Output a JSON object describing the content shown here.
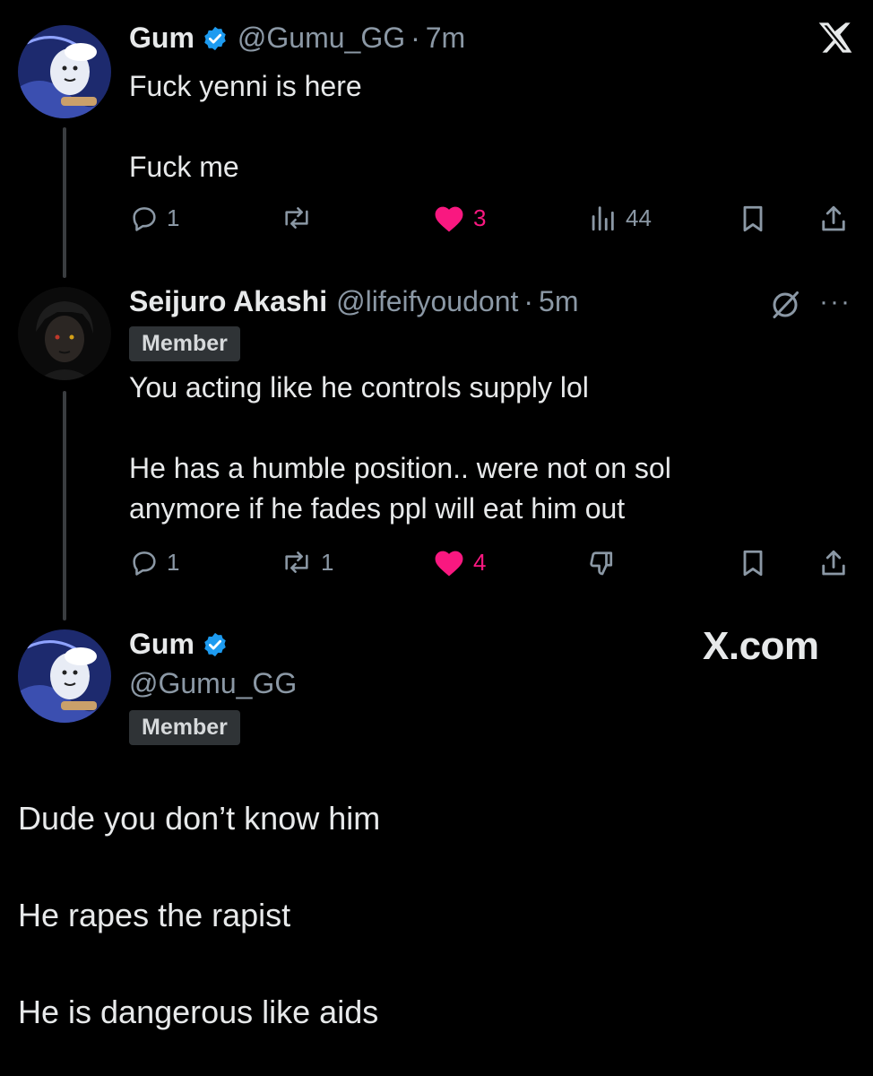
{
  "post1": {
    "name": "Gum",
    "handle": "@Gumu_GG",
    "separator": "·",
    "time": "7m",
    "text": "Fuck yenni is here\n\nFuck me",
    "replies": "1",
    "reposts": "",
    "likes": "3",
    "views": "44"
  },
  "post2": {
    "name": "Seijuro Akashi",
    "handle": "@lifeifyoudont",
    "separator": "·",
    "time": "5m",
    "badge": "Member",
    "text": "You acting like he controls supply lol\n\nHe has a humble position.. were not on sol\nanymore if he fades ppl will eat him out",
    "replies": "1",
    "reposts": "1",
    "likes": "4"
  },
  "post3": {
    "name": "Gum",
    "handle": "@Gumu_GG",
    "badge": "Member",
    "text": "Dude you don’t know him\n\nHe rapes the rapist\n\nHe is dangerous like aids"
  },
  "brand": "X.com",
  "more_menu": "···",
  "colors": {
    "like": "#f91880",
    "verified": "#1d9bf0",
    "muted": "#8b98a5",
    "badge_bg": "#2f3336"
  },
  "icons": [
    "x-logo-icon",
    "verified-badge-icon",
    "reply-icon",
    "repost-icon",
    "like-icon",
    "views-icon",
    "bookmark-icon",
    "share-icon",
    "grok-icon",
    "downvote-icon",
    "more-icon"
  ]
}
